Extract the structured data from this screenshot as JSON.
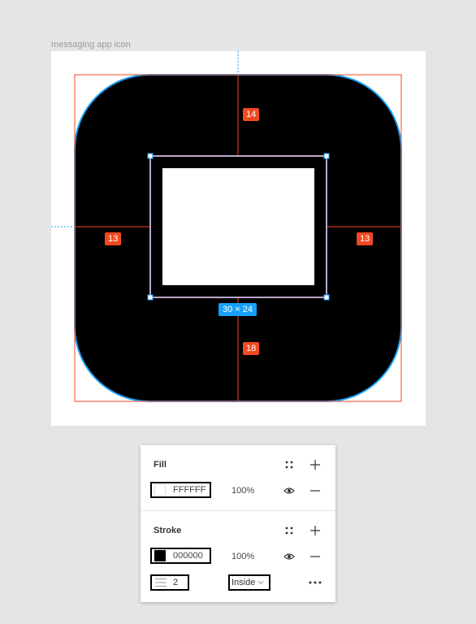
{
  "canvas": {
    "frame_label": "messaging app icon",
    "spacing": {
      "top": "14",
      "left": "13",
      "right": "13",
      "bottom": "18"
    },
    "selection_size": "30 × 24",
    "colors": {
      "selection": "#18a0fb",
      "measure": "#f24822",
      "icon_fill": "#000000",
      "inner_fill": "#ffffff"
    }
  },
  "panel": {
    "fill": {
      "title": "Fill",
      "hex": "FFFFFF",
      "opacity": "100%",
      "swatch_color": "#ffffff"
    },
    "stroke": {
      "title": "Stroke",
      "hex": "000000",
      "opacity": "100%",
      "swatch_color": "#000000",
      "weight": "2",
      "position": "Inside"
    },
    "icons": {
      "styles": "grid-dots-icon",
      "add": "plus-icon",
      "visibility": "eye-icon",
      "remove": "minus-icon",
      "stroke_weight": "stroke-lines-icon",
      "dropdown": "chevron-down-icon",
      "more": "more-dots-icon"
    }
  }
}
